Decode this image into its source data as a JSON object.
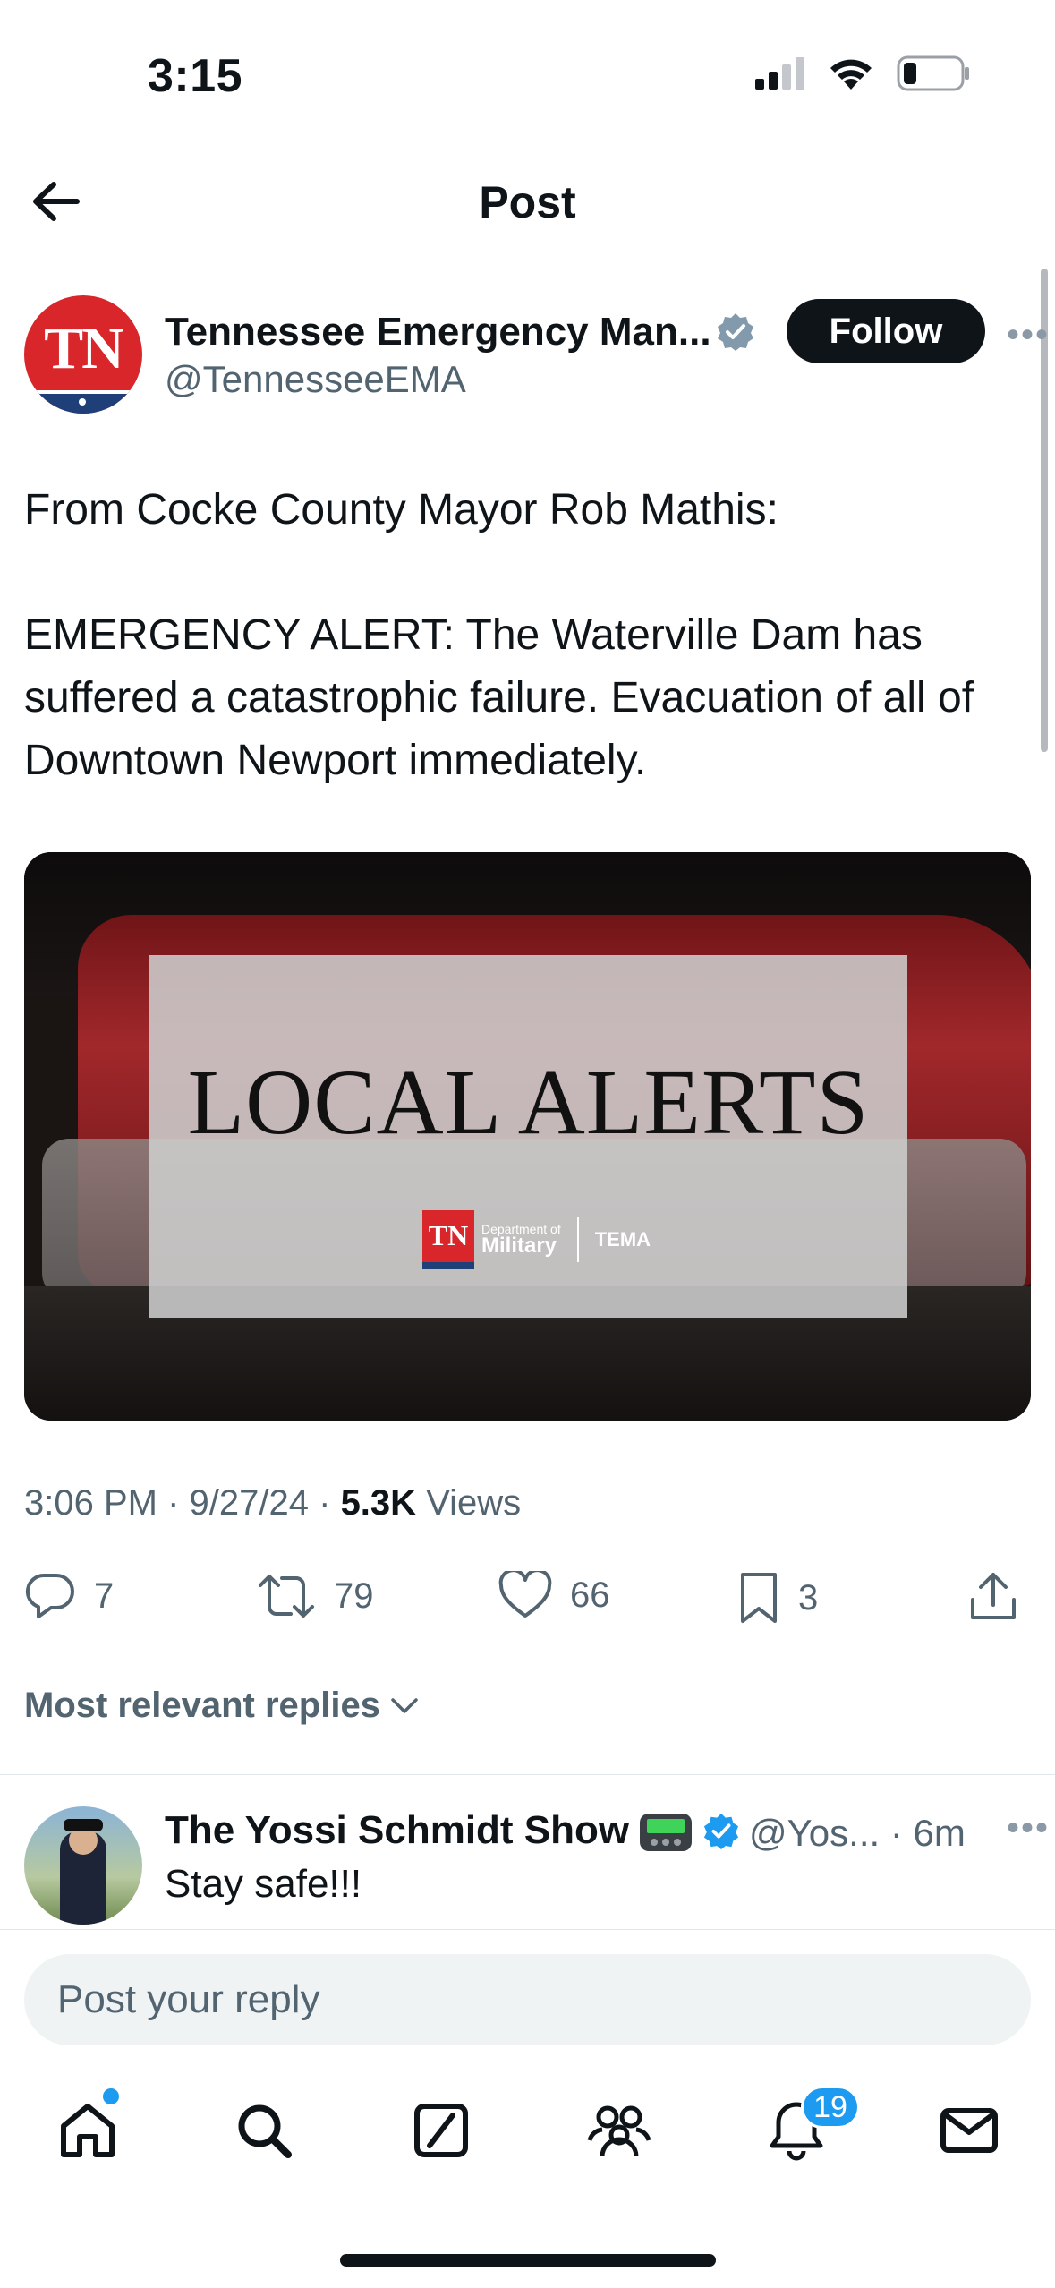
{
  "status_bar": {
    "time": "3:15"
  },
  "header": {
    "title": "Post"
  },
  "post": {
    "author_name": "Tennessee Emergency Man...",
    "author_handle": "@TennesseeEMA",
    "avatar_text": "TN",
    "follow_label": "Follow",
    "text_line1": "From Cocke County Mayor Rob Mathis:",
    "text_line2": "EMERGENCY ALERT: The Waterville Dam has suffered a catastrophic failure.  Evacuation of all of Downtown Newport immediately.",
    "media": {
      "title": "LOCAL ALERTS",
      "logo_tn": "TN",
      "logo_dept_small": "Department of",
      "logo_dept_big": "Military",
      "logo_tema": "TEMA"
    },
    "time": "3:06 PM",
    "date": "9/27/24",
    "views_count": "5.3K",
    "views_label": "Views",
    "stats": {
      "replies": "7",
      "reposts": "79",
      "likes": "66",
      "bookmarks": "3"
    }
  },
  "replies_filter": {
    "label": "Most relevant replies"
  },
  "reply": {
    "name": "The Yossi Schmidt Show",
    "handle_time": "@Yos... · 6m",
    "text": "Stay safe!!!"
  },
  "composer": {
    "placeholder": "Post your reply"
  },
  "tabbar": {
    "notifications_badge": "19"
  },
  "colors": {
    "accent": "#1d9bf0",
    "text": "#0f1419",
    "muted": "#536471",
    "brand_red": "#d9262b"
  }
}
